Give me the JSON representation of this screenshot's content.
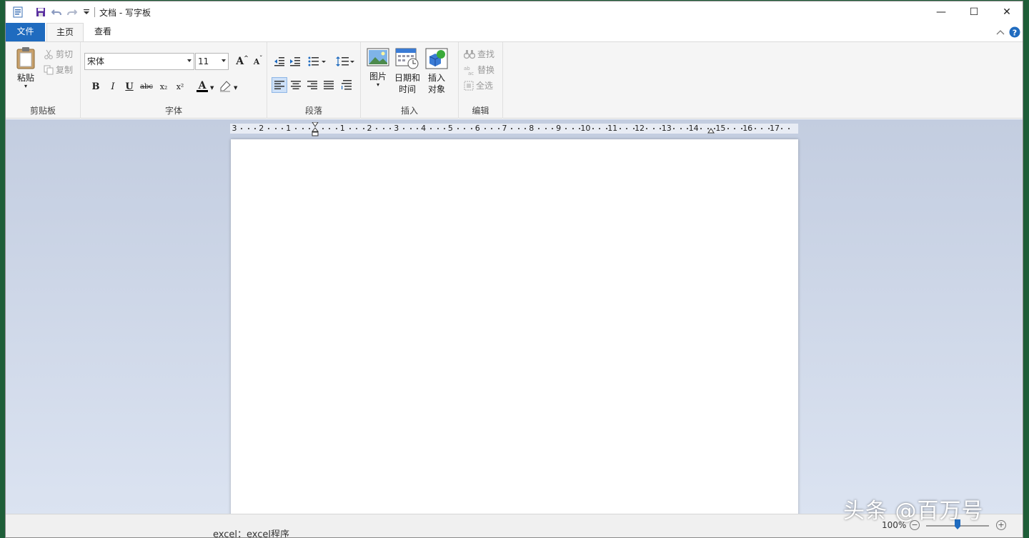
{
  "window": {
    "title": "文档 - 写字板",
    "controls": {
      "minimize": "—",
      "maximize": "☐",
      "close": "✕"
    }
  },
  "tabs": [
    {
      "label": "文件",
      "active": false
    },
    {
      "label": "主页",
      "active": true
    },
    {
      "label": "查看",
      "active": false
    }
  ],
  "ribbon": {
    "clipboard": {
      "group_label": "剪贴板",
      "paste": "粘贴",
      "cut": "剪切",
      "copy": "复制"
    },
    "font": {
      "group_label": "字体",
      "font_name": "宋体",
      "font_size": "11",
      "grow": "A",
      "shrink": "A",
      "bold": "B",
      "italic": "I",
      "underline": "U",
      "strikethrough": "abc",
      "subscript": "x₂",
      "superscript": "x²",
      "text_color_glyph": "A"
    },
    "paragraph": {
      "group_label": "段落"
    },
    "insert": {
      "group_label": "插入",
      "picture": "图片",
      "datetime_line1": "日期和",
      "datetime_line2": "时间",
      "object_line1": "插入",
      "object_line2": "对象"
    },
    "editing": {
      "group_label": "编辑",
      "find": "查找",
      "replace": "替换",
      "select_all": "全选"
    }
  },
  "ruler": {
    "labels": [
      "3",
      "2",
      "1",
      "1",
      "2",
      "3",
      "4",
      "5",
      "6",
      "7",
      "8",
      "9",
      "10",
      "11",
      "12",
      "13",
      "14",
      "15",
      "16",
      "17"
    ]
  },
  "statusbar": {
    "zoom": "100%",
    "zoom_fraction": 0.5
  },
  "watermark": "头条 @百万号",
  "bottom_fragment": "excel：excel程序",
  "colors": {
    "accent": "#1f6bbf",
    "ribbon_bg": "#f5f5f5",
    "doc_bg_top": "#c3cde0",
    "doc_bg_bottom": "#dbe3f1"
  }
}
